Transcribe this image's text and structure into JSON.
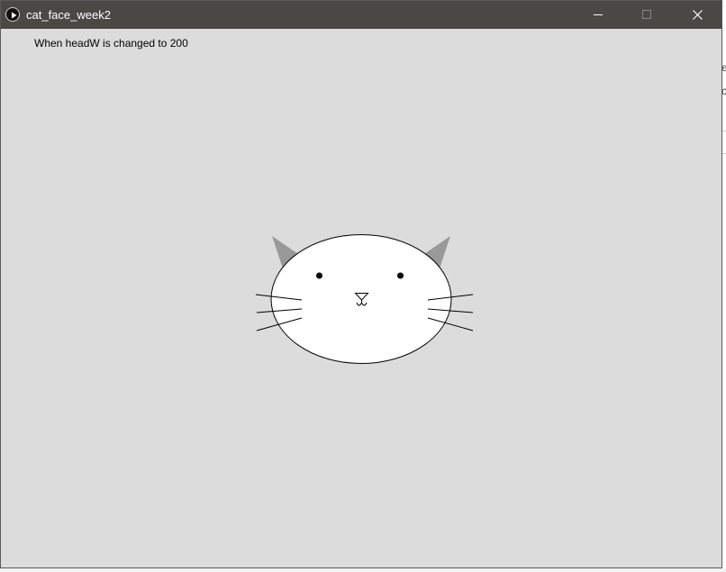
{
  "window": {
    "title": "cat_face_week2",
    "titlebar_color": "#4a4845",
    "canvas_color": "#dcdcdc",
    "app_icon": "processing-play-icon",
    "controls": {
      "minimize_icon": "minimize-icon",
      "maximize_icon": "maximize-icon",
      "close_icon": "close-icon"
    }
  },
  "canvas": {
    "label": "When headW is changed to 200",
    "cat": {
      "head_fill": "#ffffff",
      "ear_color": "#999999",
      "stroke_color": "#000000"
    }
  },
  "background_window": {
    "partial_text_1": "e",
    "partial_text_2": "c"
  }
}
